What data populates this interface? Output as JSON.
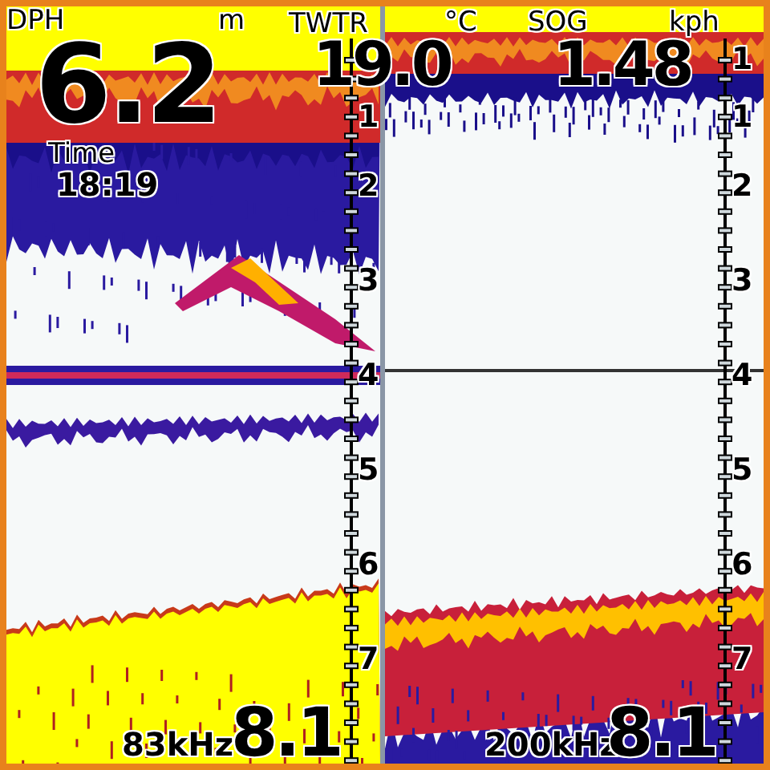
{
  "depth": {
    "label": "DPH",
    "value": "6.2",
    "unit": "m"
  },
  "water_temp": {
    "label": "TWTR",
    "value": "19.0",
    "unit": "°C"
  },
  "speed": {
    "label": "SOG",
    "value": "1.48",
    "unit": "kph"
  },
  "time": {
    "label": "Time",
    "value": "18:19"
  },
  "panes": [
    {
      "frequency": "83kHz",
      "range": "8.1",
      "scale_labels": [
        "1",
        "2",
        "3",
        "4",
        "5",
        "6",
        "7"
      ]
    },
    {
      "frequency": "200kHz",
      "range": "8.1",
      "scale_labels": [
        "1",
        "1",
        "2",
        "3",
        "4",
        "5",
        "6",
        "7"
      ]
    }
  ]
}
